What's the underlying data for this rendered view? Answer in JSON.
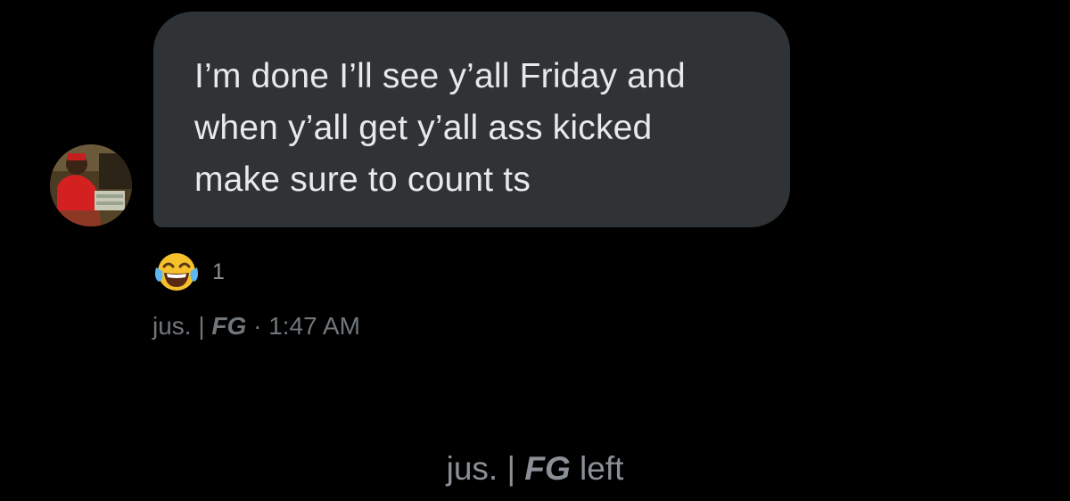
{
  "message": {
    "lines": [
      "I’m done I’ll see y’all Friday and",
      "when y’all get y’all ass kicked",
      "make sure to count ts"
    ],
    "reaction": {
      "emoji": "face-with-tears-of-joy",
      "count": "1"
    },
    "sender": {
      "name_plain": "jus. | ",
      "name_bold": "FG",
      "separator": " · ",
      "time": "1:47 AM"
    }
  },
  "system_event": {
    "name_plain": "jus. | ",
    "name_bold": "FG",
    "suffix": " left"
  },
  "colors": {
    "background": "#000000",
    "bubble": "#2f3336",
    "text": "#e7e9ea",
    "muted": "#71767b"
  }
}
